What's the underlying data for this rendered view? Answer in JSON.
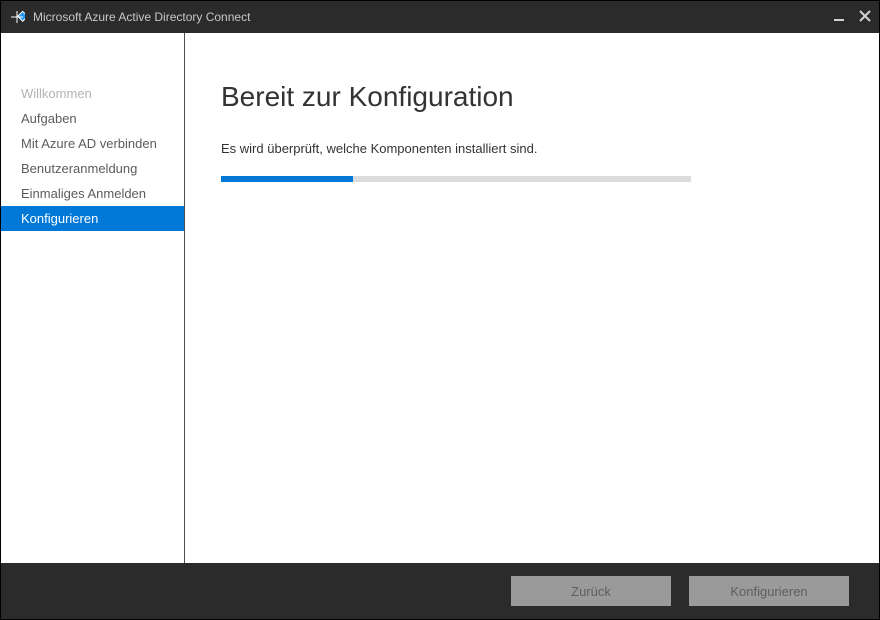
{
  "window": {
    "title": "Microsoft Azure Active Directory Connect"
  },
  "sidebar": {
    "items": [
      {
        "label": "Willkommen",
        "state": "disabled"
      },
      {
        "label": "Aufgaben",
        "state": "normal"
      },
      {
        "label": "Mit Azure AD verbinden",
        "state": "normal"
      },
      {
        "label": "Benutzeranmeldung",
        "state": "normal"
      },
      {
        "label": "Einmaliges Anmelden",
        "state": "normal"
      },
      {
        "label": "Konfigurieren",
        "state": "active"
      }
    ]
  },
  "main": {
    "title": "Bereit zur Konfiguration",
    "status": "Es wird überprüft, welche Komponenten installiert sind.",
    "progress_percent": 28
  },
  "footer": {
    "back_label": "Zurück",
    "configure_label": "Konfigurieren"
  },
  "colors": {
    "accent": "#0078d7",
    "titlebar_bg": "#2b2b2b"
  }
}
